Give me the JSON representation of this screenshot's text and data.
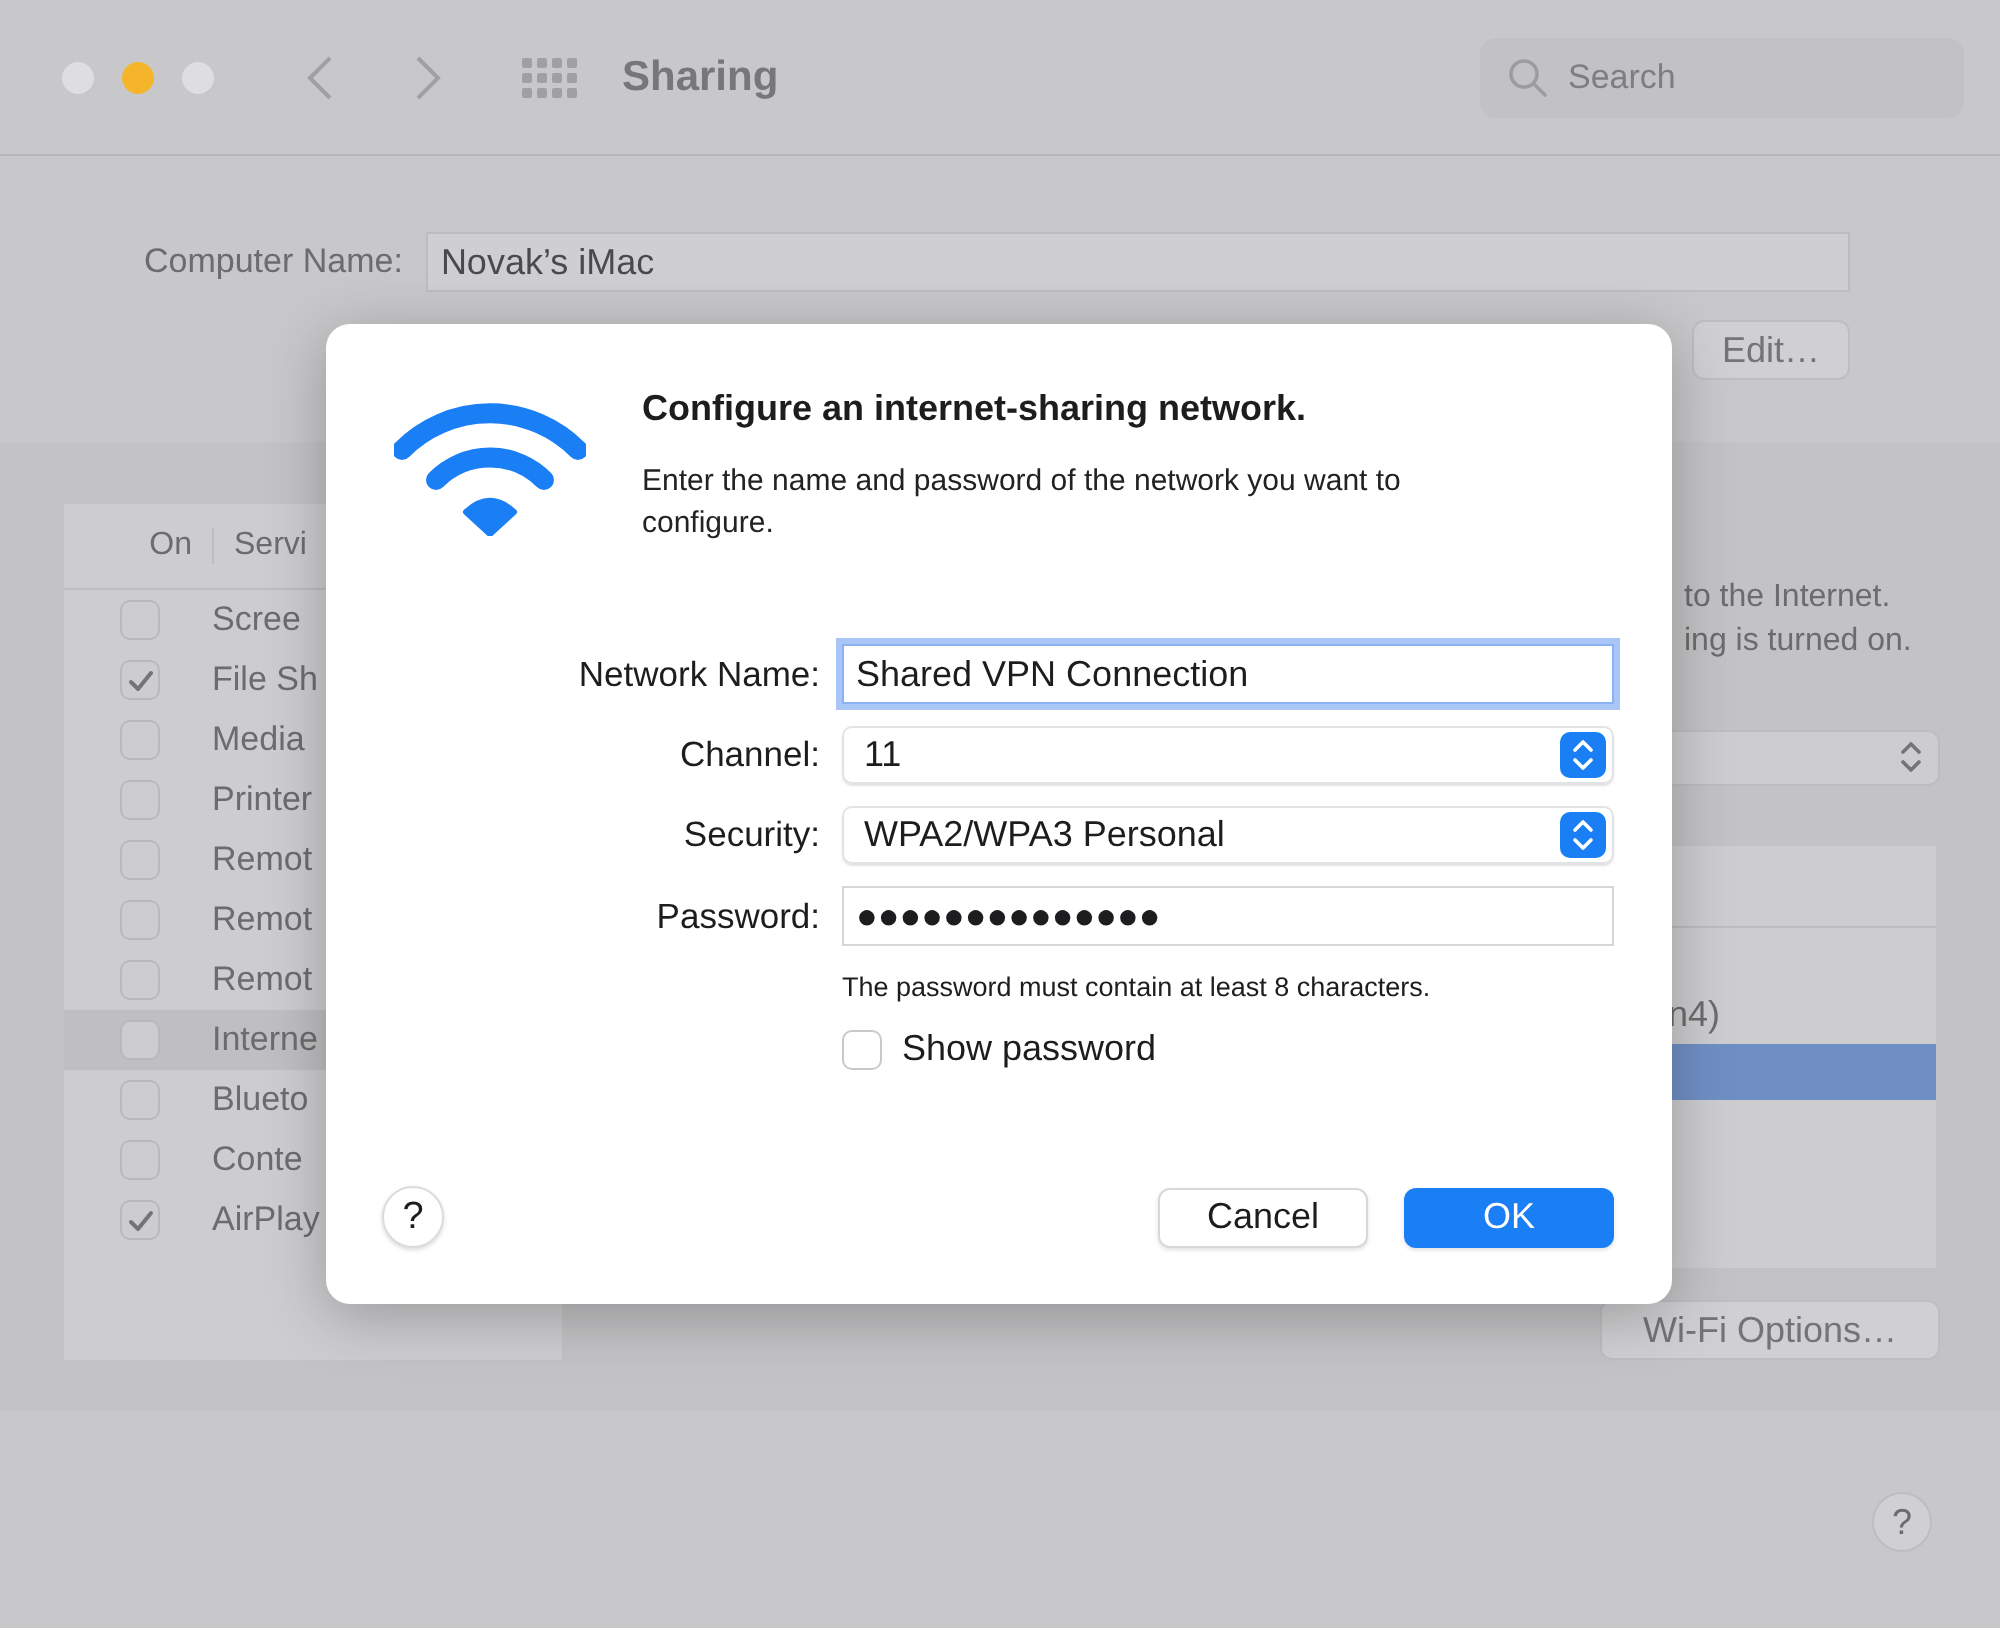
{
  "window": {
    "title": "Sharing",
    "search": {
      "placeholder": "Search"
    }
  },
  "computer_name": {
    "label": "Computer Name:",
    "value": "Novak’s iMac",
    "edit_button": "Edit…"
  },
  "services": {
    "columns": [
      "On",
      "Servi"
    ],
    "rows": [
      {
        "name": "Scree",
        "checked": false,
        "selected": false
      },
      {
        "name": "File Sh",
        "checked": true,
        "selected": false
      },
      {
        "name": "Media",
        "checked": false,
        "selected": false
      },
      {
        "name": "Printer",
        "checked": false,
        "selected": false
      },
      {
        "name": "Remot",
        "checked": false,
        "selected": false
      },
      {
        "name": "Remot",
        "checked": false,
        "selected": false
      },
      {
        "name": "Remot",
        "checked": false,
        "selected": false
      },
      {
        "name": "Interne",
        "checked": false,
        "selected": true
      },
      {
        "name": "Blueto",
        "checked": false,
        "selected": false
      },
      {
        "name": "Conte",
        "checked": false,
        "selected": false
      },
      {
        "name": "AirPlay",
        "checked": true,
        "selected": false
      }
    ]
  },
  "internet_sharing": {
    "description_lines": [
      "to the Internet.",
      "ing is turned on."
    ],
    "ports": [
      {
        "label": "n4)",
        "selected": false
      },
      {
        "selected": true
      }
    ],
    "wifi_options_button": "Wi-Fi Options…"
  },
  "help_button": "?",
  "dialog": {
    "title": "Configure an internet-sharing network.",
    "message": "Enter the name and password of the network you want to configure.",
    "fields": [
      {
        "kind": "text",
        "label": "Network Name:",
        "value": "Shared VPN Connection",
        "focused": true
      },
      {
        "kind": "popup",
        "label": "Channel:",
        "value": "11",
        "focused": false
      },
      {
        "kind": "popup",
        "label": "Security:",
        "value": "WPA2/WPA3 Personal",
        "focused": false
      },
      {
        "kind": "password",
        "label": "Password:",
        "value": "●●●●●●●●●●●●●●",
        "focused": false
      }
    ],
    "hint": "The password must contain at least 8 characters.",
    "show_password": {
      "label": "Show password",
      "checked": false
    },
    "help_button": "?",
    "buttons": [
      {
        "label": "Cancel",
        "kind": "secondary"
      },
      {
        "label": "OK",
        "kind": "primary"
      }
    ]
  }
}
